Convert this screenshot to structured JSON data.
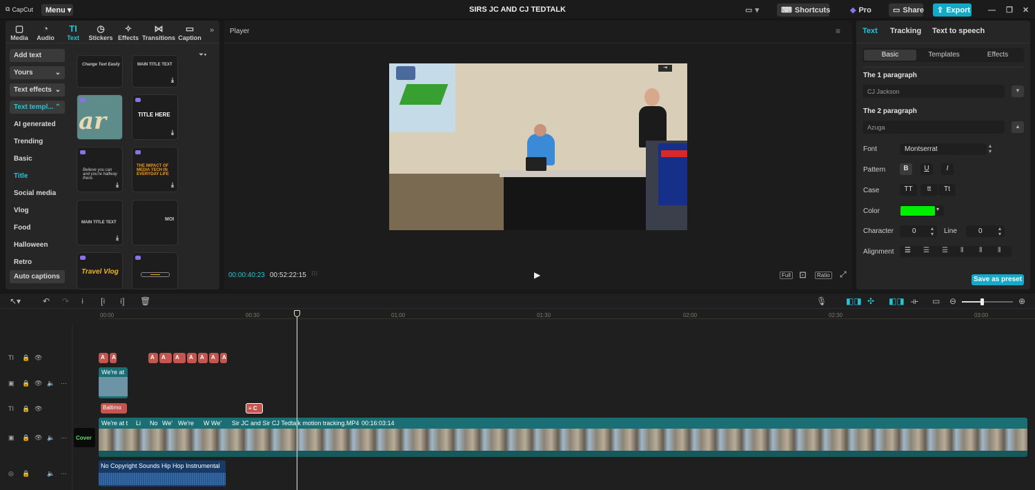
{
  "app": {
    "logo": "CapCut",
    "menu": "Menu",
    "title": "SIRS JC AND CJ TEDTALK",
    "shortcuts": "Shortcuts",
    "pro": "Pro",
    "share": "Share",
    "export": "Export"
  },
  "categories": [
    {
      "label": "Media",
      "icon": "▢"
    },
    {
      "label": "Audio",
      "icon": "◔"
    },
    {
      "label": "Text",
      "icon": "TI"
    },
    {
      "label": "Stickers",
      "icon": "◷"
    },
    {
      "label": "Effects",
      "icon": "✧"
    },
    {
      "label": "Transitions",
      "icon": "⋈"
    },
    {
      "label": "Caption",
      "icon": "▭"
    }
  ],
  "sidebar": {
    "add_text": "Add text",
    "yours": "Yours",
    "text_effects": "Text effects",
    "text_templates": "Text templ...",
    "items": [
      "AI generated",
      "Trending",
      "Basic",
      "Title",
      "Social media",
      "Vlog",
      "Food",
      "Halloween",
      "Retro"
    ],
    "auto_captions": "Auto captions"
  },
  "tiles": {
    "t1": "Change Text Easily",
    "t2": "MAIN TITLE TEXT",
    "t3": "TITLE HERE",
    "t4": "Believe you can and you're halfway there.",
    "t5": "THE IMPACT OF MEDIA TECH IN EVERYDAY LIFE",
    "t6": "MAIN TITLE TEXT",
    "t7": "MOI",
    "t8": "Travel Vlog"
  },
  "player": {
    "label": "Player",
    "current_time": "00:00:40:23",
    "total_time": "00:52:22:15",
    "full": "Full",
    "ratio": "Ratio"
  },
  "right": {
    "tabs": [
      "Text",
      "Tracking",
      "Text to speech"
    ],
    "subtabs": [
      "Basic",
      "Templates",
      "Effects"
    ],
    "p1_label": "The 1 paragraph",
    "p1_value": "CJ Jackson",
    "p2_label": "The 2 paragraph",
    "p2_value": "Azuga",
    "font_label": "Font",
    "font_value": "Montserrat",
    "pattern_label": "Pattern",
    "pattern_b": "B",
    "pattern_u": "U",
    "pattern_i": "I",
    "case_label": "Case",
    "case_upper": "TT",
    "case_lower": "tt",
    "case_title": "Tt",
    "color_label": "Color",
    "color_value": "#00ee00",
    "character_label": "Character",
    "character_value": "0",
    "line_label": "Line",
    "line_value": "0",
    "alignment_label": "Alignment",
    "save_preset": "Save as preset"
  },
  "timeline": {
    "ticks": [
      "00:00",
      "00:30",
      "01:00",
      "01:30",
      "02:00",
      "02:30",
      "03:00"
    ],
    "clip_weare": "We're at t",
    "clip_baltimore": "Baltimo",
    "main_clip_labels": [
      "We're at t",
      "Li",
      "No",
      "We'",
      "We're",
      "W",
      "We'"
    ],
    "main_clip_name": "Sir JC and Sir CJ Tedtalk motion tracking.MP4",
    "main_clip_duration": "00:16:03:14",
    "cover": "Cover",
    "audio_clip": "No Copyright Sounds  Hip Hop Instrumental",
    "text_clip_label": "A"
  },
  "colors": {
    "accent": "#25c5d5",
    "export": "#13a9c9",
    "text_clip": "#c4564f",
    "video_clip": "#1a6f74",
    "audio_clip": "#163b66",
    "playhead": "#e8e8e8"
  }
}
